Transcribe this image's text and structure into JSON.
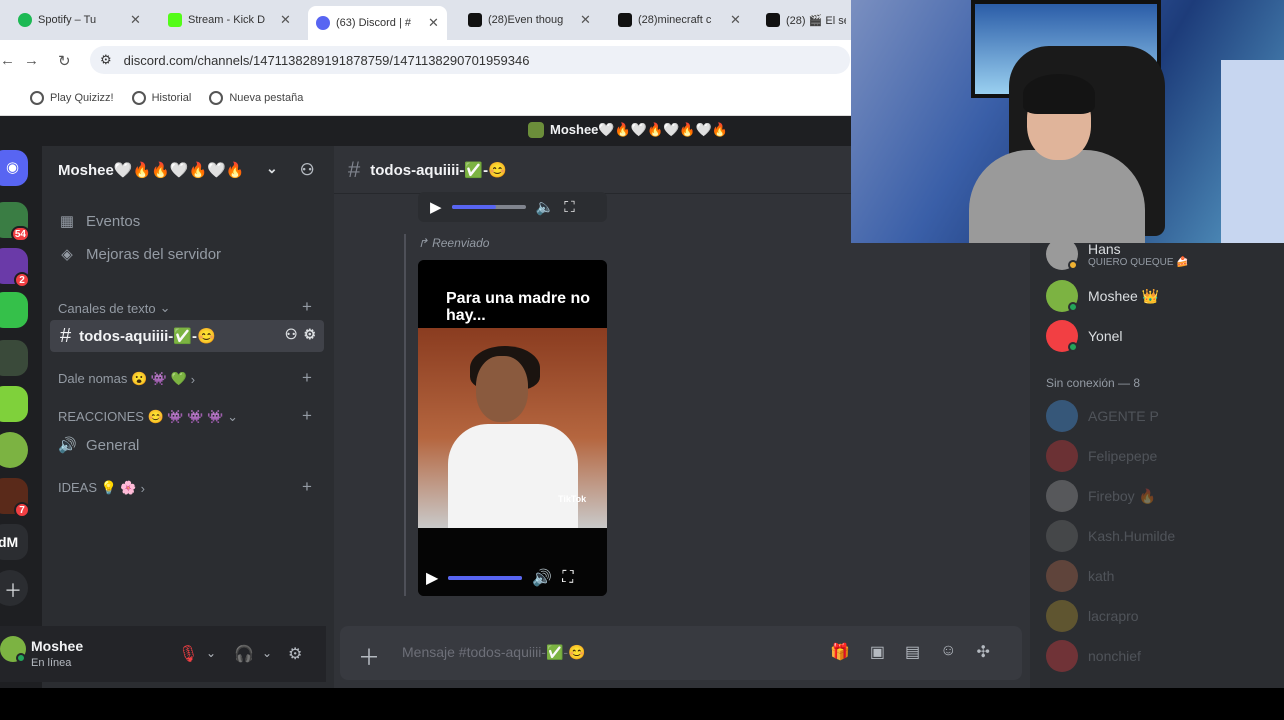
{
  "browser": {
    "tabs": [
      {
        "title": "Spotify – Tu",
        "color": "#1db954"
      },
      {
        "title": "Stream - Kick D",
        "color": "#53fc18"
      },
      {
        "title": "(63) Discord | #",
        "color": "#5865f2"
      },
      {
        "title": "(28)Even thoug",
        "color": "#111111"
      },
      {
        "title": "(28)minecraft c",
        "color": "#111111"
      },
      {
        "title": "(28) 🎬 El se",
        "color": "#111111"
      }
    ],
    "url": "discord.com/channels/1471138289191878759/1471138290701959346",
    "bookmarks": [
      "Play Quizizz!",
      "Historial",
      "Nueva pestaña"
    ]
  },
  "discord": {
    "window_title": "Moshee🤍🔥🤍🔥🤍🔥🤍🔥",
    "server_badges": [
      "54",
      "2",
      "7"
    ],
    "server_label": "dM",
    "guild_name": "Moshee🤍🔥🔥🤍🔥🤍🔥",
    "nav_items": [
      "Eventos",
      "Mejoras del servidor"
    ],
    "categories": [
      "Canales de texto",
      "Dale nomas 😮 👾 💚",
      "REACCIONES 😊 👾 👾 👾",
      "IDEAS 💡 🌸"
    ],
    "active_channel": "todos-aquiiii-✅-😊",
    "voice_channel": "General",
    "user": {
      "name": "Moshee",
      "status": "En línea"
    },
    "chat": {
      "channel_name": "todos-aquiiii-✅-😊",
      "forwarded_label": "Reenviado",
      "video_caption": "Para una madre no hay...",
      "watermark": "TikTok",
      "composer_placeholder": "Mensaje #todos-aquiiii-✅-😊",
      "video1_volume": 0.6,
      "video2_volume": 1.0
    },
    "members": {
      "online": [
        {
          "name": "Hans",
          "sub": "QUIERO QUEQUE 🍰",
          "color": "#9a9a9a"
        },
        {
          "name": "Moshee 👑",
          "color": "#7cb342"
        },
        {
          "name": "Yonel",
          "color": "#f23f43"
        }
      ],
      "offline_title": "Sin conexión — 8",
      "offline": [
        {
          "name": "AGENTE P",
          "color": "#4da6ff"
        },
        {
          "name": "Felipepepe",
          "color": "#e23a3a"
        },
        {
          "name": "Fireboy 🔥",
          "color": "#aaaaaa"
        },
        {
          "name": "Kash.Humilde",
          "color": "#777777"
        },
        {
          "name": "kath",
          "color": "#c07050"
        },
        {
          "name": "lacrapro",
          "color": "#c0a030"
        },
        {
          "name": "nonchief",
          "color": "#f23f43"
        }
      ]
    }
  }
}
